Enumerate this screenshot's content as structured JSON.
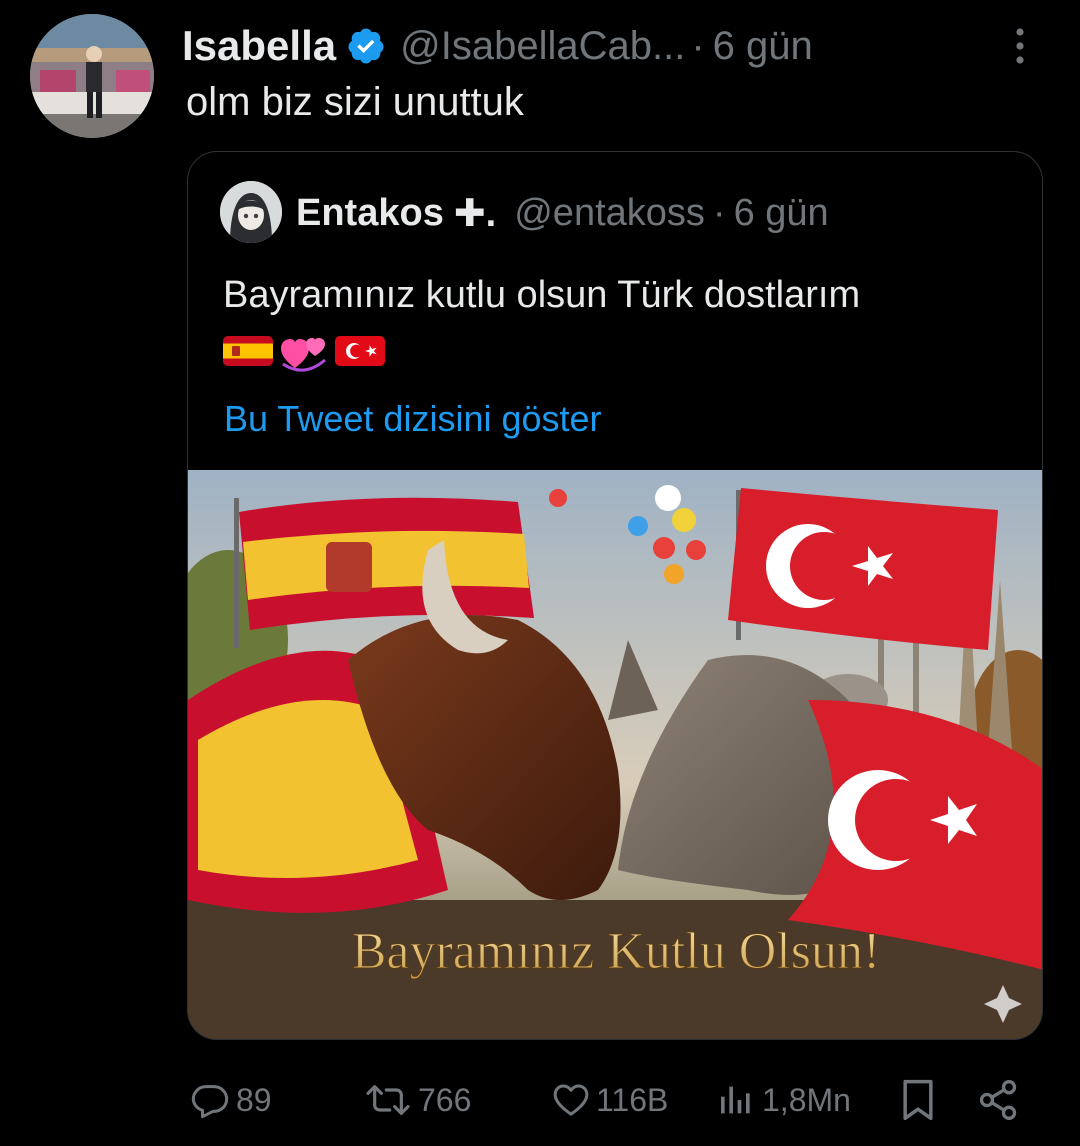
{
  "tweet": {
    "author_name": "Isabella",
    "author_handle": "@IsabellaCab...",
    "separator": "·",
    "time": "6 gün",
    "text": "olm biz sizi unuttuk"
  },
  "quoted_tweet": {
    "author_name": "Entakos",
    "author_suffix": "✚.",
    "author_handle": "@entakoss",
    "separator": "·",
    "time": "6 gün",
    "text": "Bayramınız kutlu olsun Türk dostlarım",
    "emojis": [
      "spain-flag",
      "revolving-hearts",
      "turkey-flag"
    ],
    "thread_link": "Bu Tweet dizisini göster",
    "image_caption": "Bayramınız Kutlu Olsun!"
  },
  "actions": {
    "replies": "89",
    "retweets": "766",
    "likes": "116B",
    "views": "1,8Mn"
  },
  "colors": {
    "background": "#000000",
    "text": "#e7e9ea",
    "muted": "#71767b",
    "link": "#1d9bf0",
    "border": "#2f3336",
    "verified": "#1d9bf0"
  }
}
